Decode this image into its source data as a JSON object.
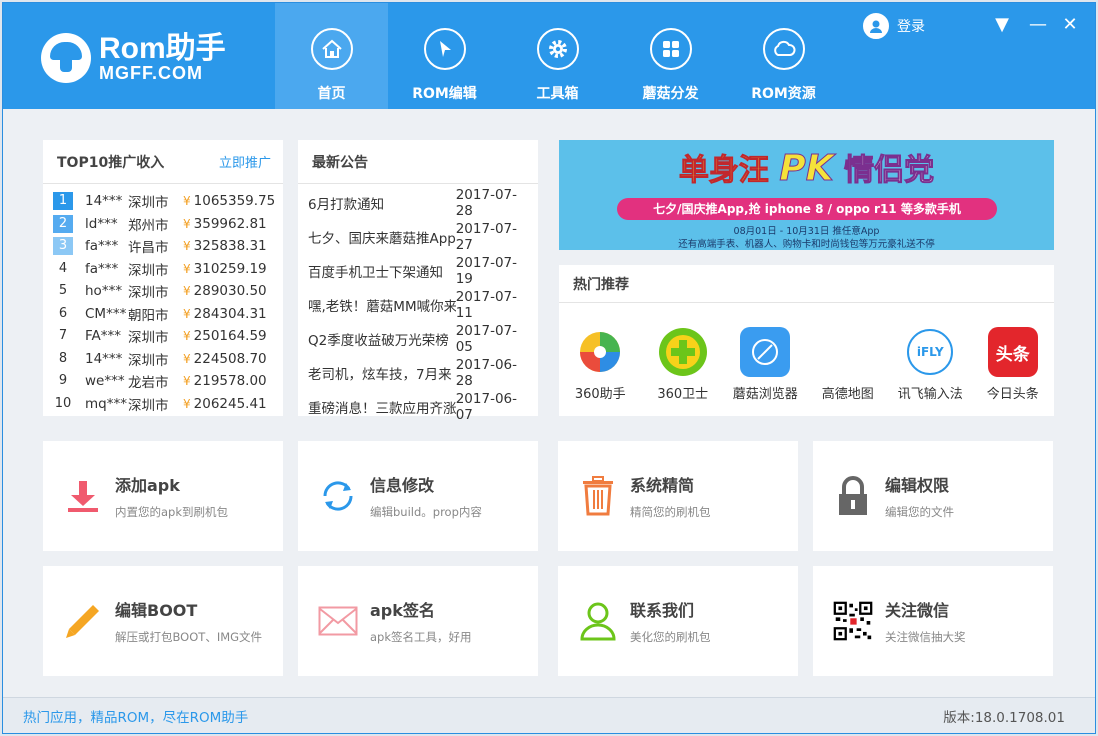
{
  "header": {
    "logo_title": "Rom助手",
    "logo_sub": "MGFF.COM",
    "login_label": "登录",
    "nav": [
      {
        "label": "首页",
        "icon": "home-icon"
      },
      {
        "label": "ROM编辑",
        "icon": "cursor-icon"
      },
      {
        "label": "工具箱",
        "icon": "gear-icon"
      },
      {
        "label": "蘑菇分发",
        "icon": "grid-icon"
      },
      {
        "label": "ROM资源",
        "icon": "cloud-icon"
      }
    ],
    "window_controls": [
      "▼",
      "—",
      "✕"
    ]
  },
  "top10": {
    "title": "TOP10推广收入",
    "link": "立即推广",
    "rows": [
      {
        "rank": "1",
        "user": "14***",
        "city": "深圳市",
        "yen": "¥",
        "amount": "1065359.75"
      },
      {
        "rank": "2",
        "user": "ld***",
        "city": "郑州市",
        "yen": "¥",
        "amount": "359962.81"
      },
      {
        "rank": "3",
        "user": "fa***",
        "city": "许昌市",
        "yen": "¥",
        "amount": "325838.31"
      },
      {
        "rank": "4",
        "user": "fa***",
        "city": "深圳市",
        "yen": "¥",
        "amount": "310259.19"
      },
      {
        "rank": "5",
        "user": "ho***",
        "city": "深圳市",
        "yen": "¥",
        "amount": "289030.50"
      },
      {
        "rank": "6",
        "user": "CM***",
        "city": "朝阳市",
        "yen": "¥",
        "amount": "284304.31"
      },
      {
        "rank": "7",
        "user": "FA***",
        "city": "深圳市",
        "yen": "¥",
        "amount": "250164.59"
      },
      {
        "rank": "8",
        "user": "14***",
        "city": "深圳市",
        "yen": "¥",
        "amount": "224508.70"
      },
      {
        "rank": "9",
        "user": "we***",
        "city": "龙岩市",
        "yen": "¥",
        "amount": "219578.00"
      },
      {
        "rank": "10",
        "user": "mq***",
        "city": "深圳市",
        "yen": "¥",
        "amount": "206245.41"
      }
    ]
  },
  "notices": {
    "title": "最新公告",
    "rows": [
      {
        "title": "6月打款通知",
        "date": "2017-07-28"
      },
      {
        "title": "七夕、国庆来蘑菇推App",
        "date": "2017-07-27"
      },
      {
        "title": "百度手机卫士下架通知",
        "date": "2017-07-19"
      },
      {
        "title": "嘿,老铁！蘑菇MM喊你来",
        "date": "2017-07-11"
      },
      {
        "title": "Q2季度收益破万光荣榜",
        "date": "2017-07-05"
      },
      {
        "title": "老司机，炫车技，7月来",
        "date": "2017-06-28"
      },
      {
        "title": "重磅消息！三款应用齐涨",
        "date": "2017-06-07"
      }
    ]
  },
  "banner": {
    "headline_left": "单身汪",
    "headline_pk": "PK",
    "headline_right": "情侣党",
    "line1": "七夕/国庆推App,抢 iphone 8 / oppo r11 等多款手机",
    "line2": "08月01日 - 10月31日  推任意App",
    "line3": "还有高端手表、机器人、购物卡和时尚钱包等万元豪礼送不停"
  },
  "hot": {
    "title": "热门推荐",
    "apps": [
      {
        "label": "360助手",
        "icon": "360-assistant-icon",
        "color": "#f5f5f5"
      },
      {
        "label": "360卫士",
        "icon": "360-guard-icon",
        "color": "#6cc51a"
      },
      {
        "label": "蘑菇浏览器",
        "icon": "mushroom-browser-icon",
        "color": "#3a9cf0"
      },
      {
        "label": "高德地图",
        "icon": "amap-icon",
        "color": "#ffffff"
      },
      {
        "label": "讯飞输入法",
        "icon": "iflytek-icon",
        "color": "#ffffff"
      },
      {
        "label": "今日头条",
        "icon": "toutiao-icon",
        "color": "#e3262c"
      }
    ],
    "iflytek_text": "iFLY",
    "toutiao_text": "头条"
  },
  "tools": [
    {
      "title": "添加apk",
      "desc": "内置您的apk到刷机包",
      "icon": "download-icon"
    },
    {
      "title": "信息修改",
      "desc": "编辑build。prop内容",
      "icon": "refresh-icon"
    },
    {
      "title": "系统精简",
      "desc": "精简您的刷机包",
      "icon": "trash-icon"
    },
    {
      "title": "编辑权限",
      "desc": "编辑您的文件",
      "icon": "lock-icon"
    },
    {
      "title": "编辑BOOT",
      "desc": "解压或打包BOOT、IMG文件",
      "icon": "pencil-icon"
    },
    {
      "title": "apk签名",
      "desc": "apk签名工具，好用",
      "icon": "envelope-icon"
    },
    {
      "title": "联系我们",
      "desc": "美化您的刷机包",
      "icon": "person-icon"
    },
    {
      "title": "关注微信",
      "desc": "关注微信抽大奖",
      "icon": "qrcode-icon"
    }
  ],
  "footer": {
    "slogan": "热门应用，精品ROM，尽在ROM助手",
    "version": "版本:18.0.1708.01"
  },
  "colors": {
    "accent": "#2b98ea",
    "yen": "#f29e1f",
    "download": "#f05a6e",
    "trash": "#f07c3f",
    "pencil": "#f5a623",
    "contact": "#6cc51a"
  }
}
